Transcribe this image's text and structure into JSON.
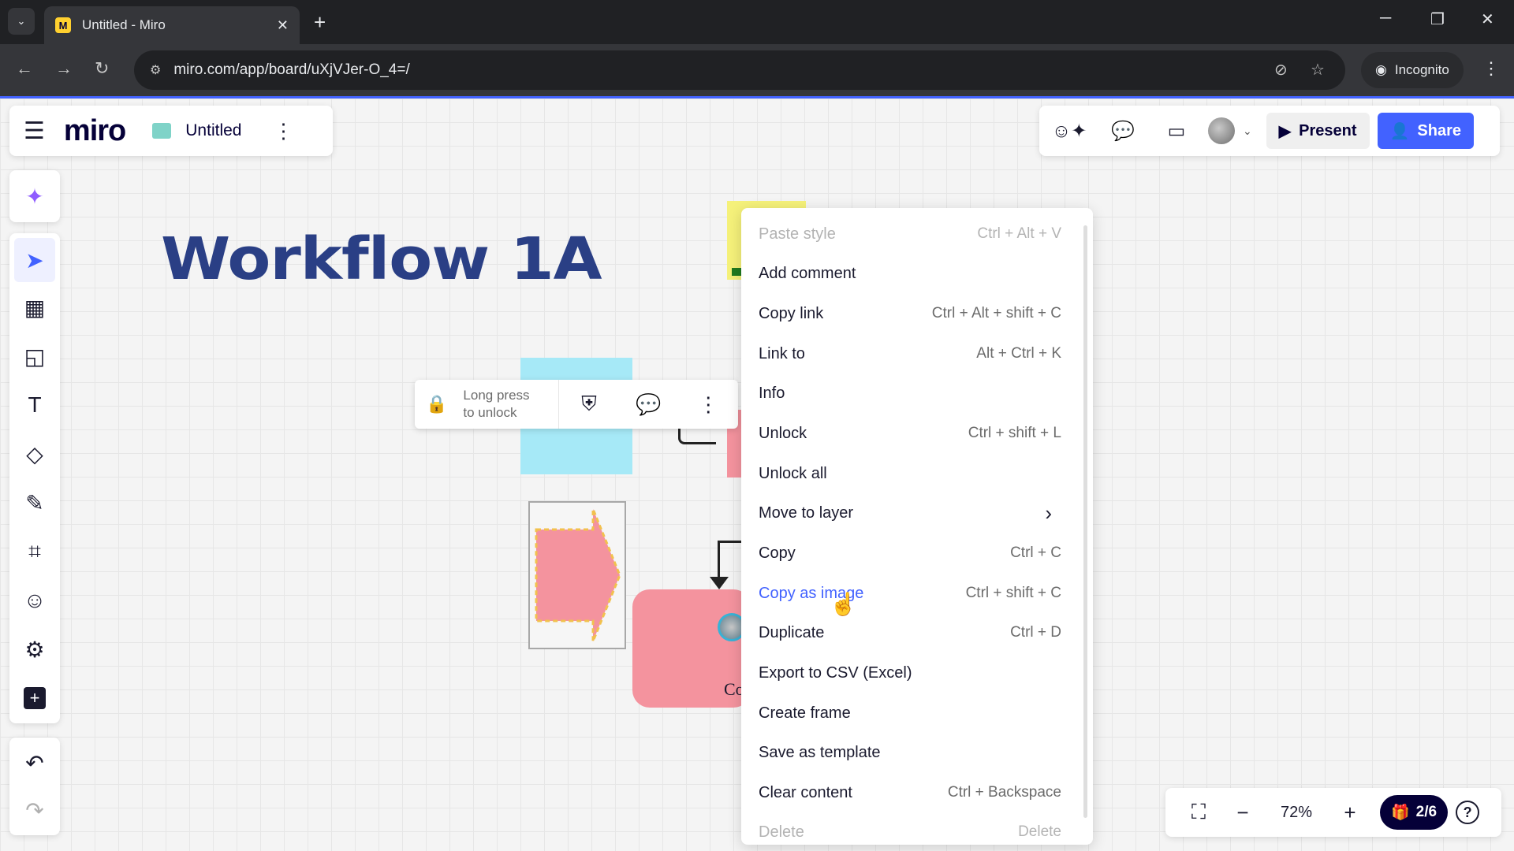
{
  "browser": {
    "tab_title": "Untitled - Miro",
    "favicon_letter": "M",
    "url": "miro.com/app/board/uXjVJer-O_4=/",
    "incognito_label": "Incognito"
  },
  "header": {
    "logo": "miro",
    "board_title": "Untitled",
    "present_label": "Present",
    "share_label": "Share"
  },
  "board": {
    "title": "Workflow 1A",
    "pink_block_text": "Co"
  },
  "lock_toolbar": {
    "text_line1": "Long press",
    "text_line2": "to unlock"
  },
  "context_menu": {
    "items": [
      {
        "label": "Paste style",
        "shortcut": "Ctrl + Alt + V",
        "state": "disabled"
      },
      {
        "label": "Add comment",
        "shortcut": "",
        "state": "normal"
      },
      {
        "label": "Copy link",
        "shortcut": "Ctrl + Alt + shift + C",
        "state": "normal"
      },
      {
        "label": "Link to",
        "shortcut": "Alt + Ctrl + K",
        "state": "normal"
      },
      {
        "label": "Info",
        "shortcut": "",
        "state": "normal"
      },
      {
        "label": "Unlock",
        "shortcut": "Ctrl + shift + L",
        "state": "normal"
      },
      {
        "label": "Unlock all",
        "shortcut": "",
        "state": "normal"
      },
      {
        "label": "Move to layer",
        "shortcut": "›",
        "state": "normal"
      },
      {
        "label": "Copy",
        "shortcut": "Ctrl + C",
        "state": "normal"
      },
      {
        "label": "Copy as image",
        "shortcut": "Ctrl + shift + C",
        "state": "hover"
      },
      {
        "label": "Duplicate",
        "shortcut": "Ctrl + D",
        "state": "normal"
      },
      {
        "label": "Export to CSV (Excel)",
        "shortcut": "",
        "state": "normal"
      },
      {
        "label": "Create frame",
        "shortcut": "",
        "state": "normal"
      },
      {
        "label": "Save as template",
        "shortcut": "",
        "state": "normal"
      },
      {
        "label": "Clear content",
        "shortcut": "Ctrl + Backspace",
        "state": "normal"
      },
      {
        "label": "Delete",
        "shortcut": "Delete",
        "state": "disabled"
      }
    ]
  },
  "bottom_bar": {
    "zoom": "72%",
    "gift_count": "2/6"
  },
  "colors": {
    "accent": "#4262ff",
    "title": "#2a3f85",
    "sticky_yellow": "#f5f17a",
    "sticky_blue": "#a6e9f7",
    "pink": "#f4939e"
  }
}
